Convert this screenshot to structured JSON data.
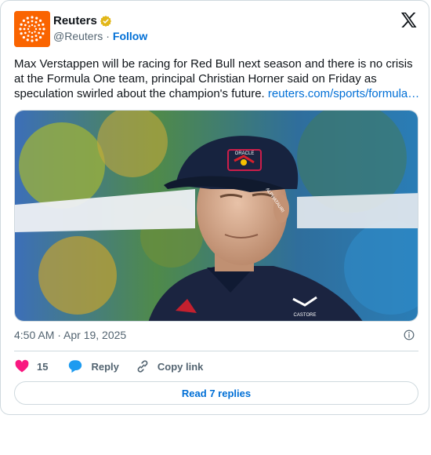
{
  "account": {
    "name": "Reuters",
    "handle": "@Reuters",
    "separator": "·",
    "follow_label": "Follow",
    "verified_icon": "gold-verified-badge"
  },
  "tweet": {
    "text": "Max Verstappen will be racing for Red Bull next season and there is no crisis at the Formula One team, principal Christian Horner said on Friday as speculation swirled about the champion's future. ",
    "link": "reuters.com/sports/formula…",
    "timestamp": "4:50 AM · Apr 19, 2025",
    "cap_text": [
      "ORACLE",
      "RED BULL RACING"
    ],
    "cap_side_text": "ALPHATAURI",
    "shirt_text": "CASTORE"
  },
  "actions": {
    "likes_count": "15",
    "reply_label": "Reply",
    "copy_label": "Copy link"
  },
  "read_replies_label": "Read 7 replies",
  "colors": {
    "brand_orange": "#fa6400",
    "link_blue": "#006fd6",
    "heart_pink": "#f91880",
    "reply_blue": "#1d9bf0",
    "muted": "#536471"
  }
}
